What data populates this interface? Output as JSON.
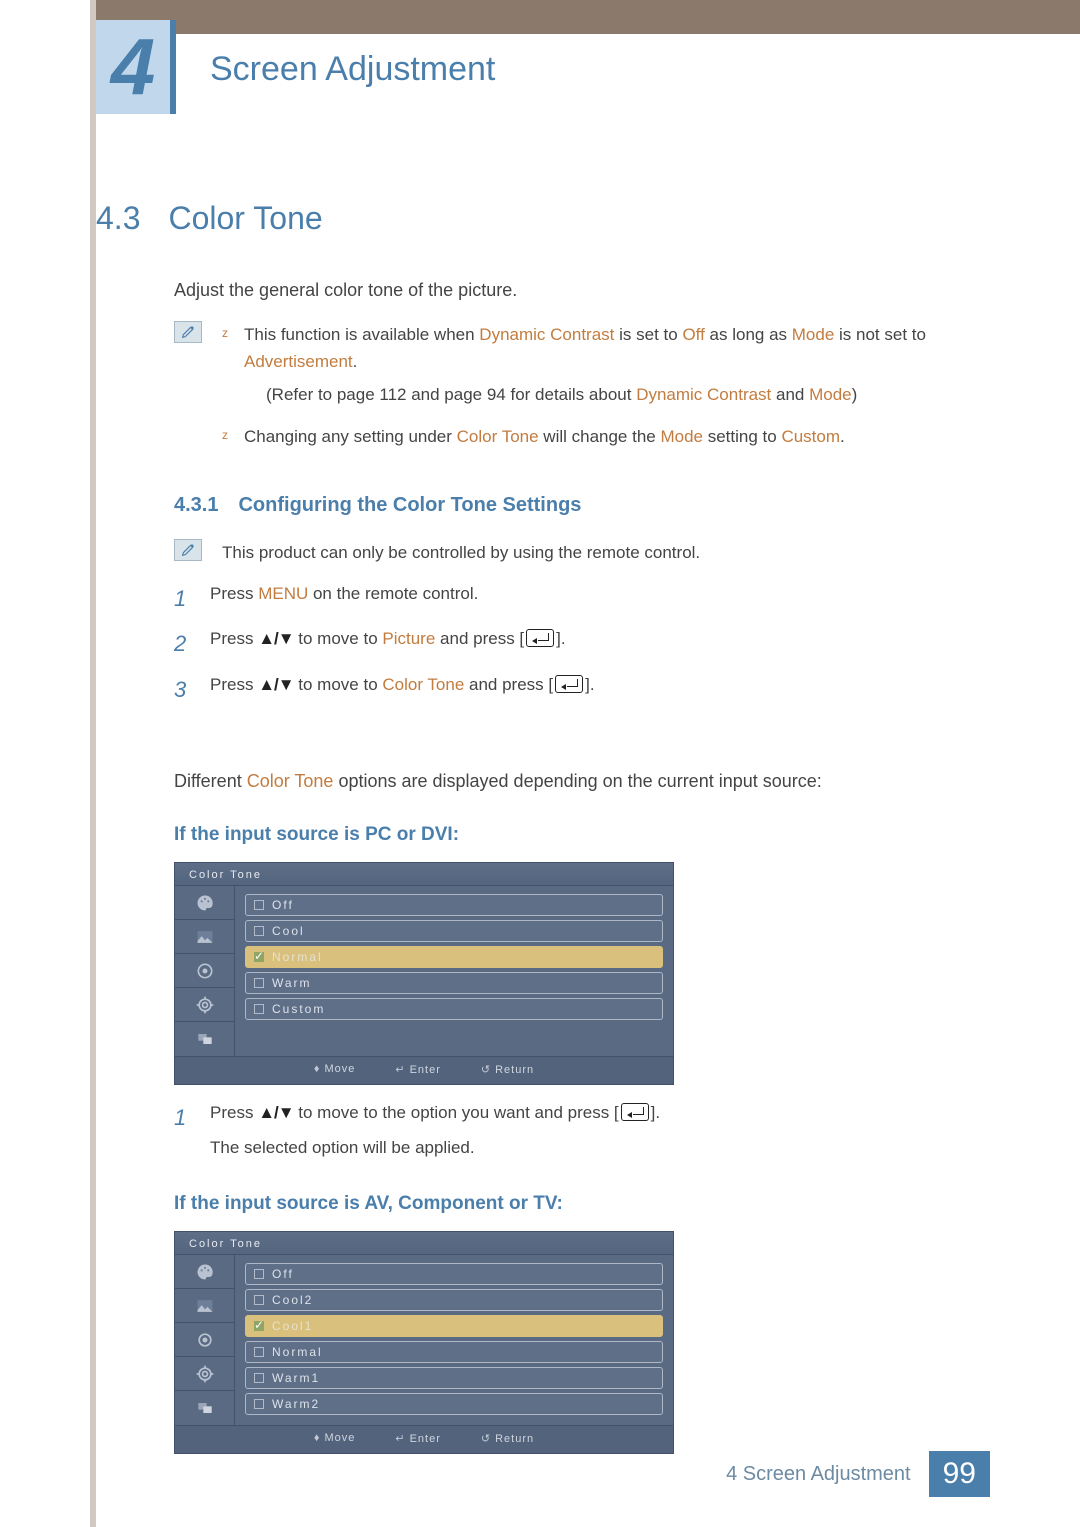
{
  "chapter": {
    "number": "4",
    "title": "Screen Adjustment"
  },
  "section": {
    "number": "4.3",
    "title": "Color Tone"
  },
  "intro": "Adjust the general color tone of the picture.",
  "notes1": {
    "b1_pre": "This function is available when ",
    "b1_k1": "Dynamic Contrast",
    "b1_mid1": " is set to ",
    "b1_k2": "Off",
    "b1_mid2": " as long as ",
    "b1_k3": "Mode",
    "b1_mid3": " is not set to ",
    "b1_k4": "Advertisement",
    "b1_post": ".",
    "b1_sub_pre": "(Refer to page 112 and page 94 for details about ",
    "b1_sub_k1": "Dynamic Contrast",
    "b1_sub_mid": " and ",
    "b1_sub_k2": "Mode",
    "b1_sub_post": ")",
    "b2_pre": "Changing any setting under ",
    "b2_k1": "Color Tone",
    "b2_mid1": " will change the ",
    "b2_k2": "Mode",
    "b2_mid2": " setting to ",
    "b2_k3": "Custom",
    "b2_post": "."
  },
  "subsection": {
    "number": "4.3.1",
    "title": "Configuring the Color Tone Settings"
  },
  "note2": "This product can only be controlled by using the remote control.",
  "steps1": {
    "s1_pre": "Press ",
    "s1_k": "MENU",
    "s1_post": " on the remote control.",
    "s2_pre": "Press ",
    "s2_mid": " to move to ",
    "s2_k": "Picture",
    "s2_post": " and press [",
    "s2_end": "].",
    "s3_pre": "Press ",
    "s3_mid": " to move to ",
    "s3_k": "Color Tone",
    "s3_post": " and press [",
    "s3_end": "]."
  },
  "diff_pre": "Different ",
  "diff_k": "Color Tone",
  "diff_post": " options are displayed depending on the current input source:",
  "case1": {
    "heading": "If the input source is PC or DVI:",
    "osd_title": "Color Tone",
    "items": [
      "Off",
      "Cool",
      "Normal",
      "Warm",
      "Custom"
    ],
    "selected_index": 2,
    "footer": {
      "move": "Move",
      "enter": "Enter",
      "return": "Return"
    }
  },
  "step4": {
    "pre": "Press ",
    "mid": " to move to the option you want and press [",
    "end": "].",
    "line2": "The selected option will be applied."
  },
  "case2": {
    "heading": "If the input source is AV, Component or TV:",
    "osd_title": "Color Tone",
    "items": [
      "Off",
      "Cool2",
      "Cool1",
      "Normal",
      "Warm1",
      "Warm2"
    ],
    "selected_index": 2,
    "footer": {
      "move": "Move",
      "enter": "Enter",
      "return": "Return"
    }
  },
  "footer": {
    "label": "4 Screen Adjustment",
    "page": "99"
  },
  "arrows": "▲/▼"
}
